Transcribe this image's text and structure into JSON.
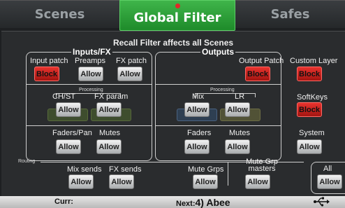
{
  "tabs": {
    "scenes": "Scenes",
    "global_filter": "Global Filter",
    "safes": "Safes"
  },
  "heading": "Recall Filter affects all Scenes",
  "inputs_fx": {
    "title": "Inputs/FX",
    "input_patch": {
      "label": "Input patch",
      "button": "Block"
    },
    "preamps": {
      "label": "Preamps",
      "button": "Allow"
    },
    "fx_patch": {
      "label": "FX patch",
      "button": "Allow"
    },
    "processing_title": "Processing",
    "ch_st": {
      "label": "CH/ST",
      "button": "Allow"
    },
    "fx_param": {
      "label": "FX param",
      "button": "Allow"
    },
    "faders_pan": {
      "label": "Faders/Pan",
      "button": "Allow"
    },
    "mutes": {
      "label": "Mutes",
      "button": "Allow"
    }
  },
  "outputs": {
    "title": "Outputs",
    "output_patch": {
      "label": "Output Patch",
      "button": "Block"
    },
    "processing_title": "Processing",
    "mix": {
      "label": "Mix",
      "button": "Allow"
    },
    "lr": {
      "label": "LR",
      "button": "Allow"
    },
    "faders": {
      "label": "Faders",
      "button": "Allow"
    },
    "mutes": {
      "label": "Mutes",
      "button": "Allow"
    }
  },
  "side": {
    "custom_layer": {
      "label": "Custom Layer",
      "button": "Block"
    },
    "softkeys": {
      "label": "SoftKeys",
      "button": "Block"
    },
    "system": {
      "label": "System",
      "button": "Allow"
    }
  },
  "routing": {
    "title": "Routing",
    "mix_sends": {
      "label": "Mix sends",
      "button": "Allow"
    },
    "fx_sends": {
      "label": "FX sends",
      "button": "Allow"
    },
    "mute_grps": {
      "label": "Mute Grps",
      "button": "Allow"
    },
    "mute_grp_masters": {
      "label": "Mute Grp masters",
      "button": "Allow"
    }
  },
  "all": {
    "label": "All",
    "button": "Allow"
  },
  "status": {
    "curr_label": "Curr:",
    "next_label": "Next:",
    "next_value": "4) Abee",
    "usb_icon": "usb-icon"
  },
  "colors": {
    "accent_green": "#2fa03a",
    "block_red": "#d0231e",
    "allow_grey": "#d8d8d8"
  }
}
